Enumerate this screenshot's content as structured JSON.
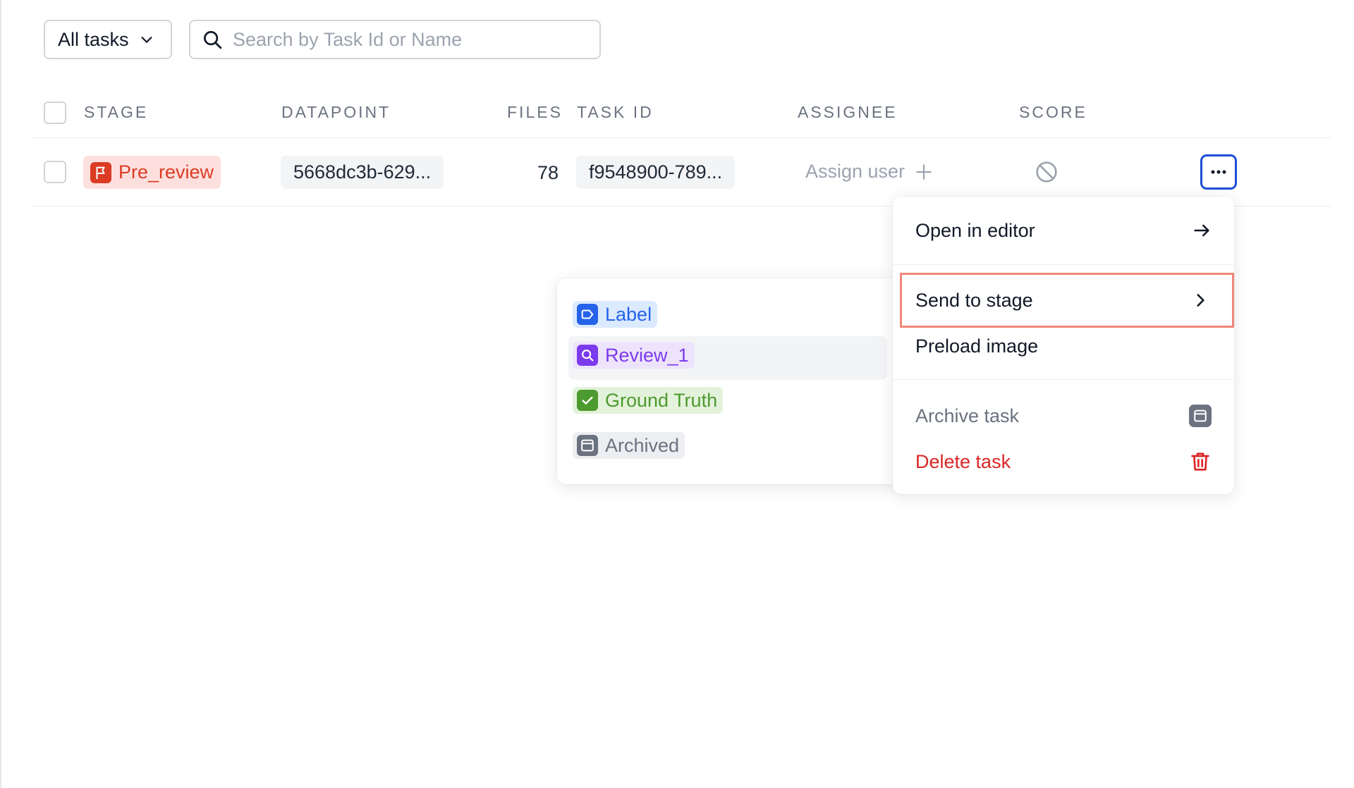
{
  "toolbar": {
    "filter_label": "All tasks",
    "search_placeholder": "Search by Task Id or Name"
  },
  "table": {
    "columns": [
      "STAGE",
      "DATAPOINT",
      "FILES",
      "TASK ID",
      "ASSIGNEE",
      "SCORE"
    ],
    "rows": [
      {
        "stage": "Pre_review",
        "datapoint": "5668dc3b-629...",
        "files": "78",
        "task_id": "f9548900-789...",
        "assignee": "Assign user"
      }
    ]
  },
  "context_menu": {
    "open_in_editor": "Open in editor",
    "send_to_stage": "Send to stage",
    "preload_image": "Preload image",
    "archive_task": "Archive task",
    "delete_task": "Delete task"
  },
  "stage_submenu": [
    {
      "label": "Label",
      "icon": "tag-icon",
      "color": "#2563eb",
      "bg": "#dbeafe"
    },
    {
      "label": "Review_1",
      "icon": "search-icon",
      "color": "#7c3aed",
      "bg": "#ede4fc"
    },
    {
      "label": "Ground Truth",
      "icon": "check-icon",
      "color": "#4d9a2e",
      "bg": "#e3f2da"
    },
    {
      "label": "Archived",
      "icon": "archive-icon",
      "color": "#6b7280",
      "bg": "#eceef1"
    }
  ],
  "colors": {
    "accent": "#1d4ed8",
    "stage_pre_review": "#dc3b24",
    "danger": "#dc2626",
    "highlight_border": "#f0857a"
  }
}
